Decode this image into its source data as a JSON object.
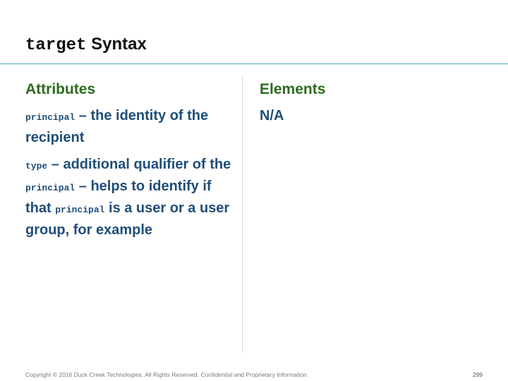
{
  "slide": {
    "title_code": "target",
    "title_text": "Syntax"
  },
  "attributes": {
    "heading": "Attributes",
    "item1": {
      "code": "principal",
      "text": "– the identity of the recipient"
    },
    "item2": {
      "code": "type",
      "text1": "– additional qualifier of the",
      "code2": "principal",
      "text2": "– helps to identify if that",
      "code3": "principal",
      "text3": "is a user or a user group, for example"
    }
  },
  "elements": {
    "heading": "Elements",
    "value": "N/A"
  },
  "footer": {
    "copyright": "Copyright © 2016 Duck Creek Technologies. All Rights Reserved. Confidential and Proprietary Information.",
    "page_number": "299"
  },
  "colors": {
    "heading": "#2e6b1f",
    "body": "#1f4e79",
    "rule": "#4aa9b3"
  }
}
